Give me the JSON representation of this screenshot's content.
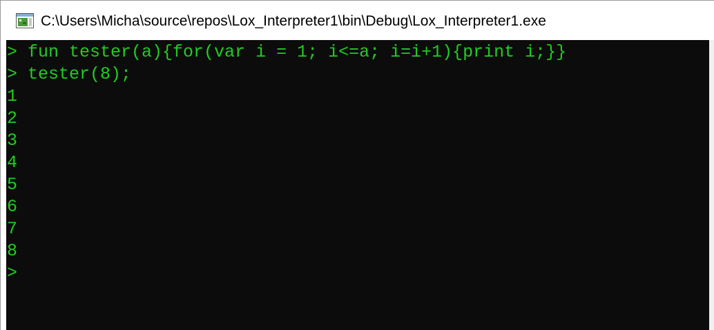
{
  "window": {
    "title": "C:\\Users\\Micha\\source\\repos\\Lox_Interpreter1\\bin\\Debug\\Lox_Interpreter1.exe",
    "icon": "console-app-icon"
  },
  "console": {
    "text_color": "#1fce1f",
    "background_color": "#0c0c0c",
    "lines": [
      {
        "prompt": "> ",
        "text": "fun tester(a){for(var i = 1; i<=a; i=i+1){print i;}}"
      },
      {
        "prompt": "> ",
        "text": "tester(8);"
      },
      {
        "prompt": "",
        "text": "1"
      },
      {
        "prompt": "",
        "text": "2"
      },
      {
        "prompt": "",
        "text": "3"
      },
      {
        "prompt": "",
        "text": "4"
      },
      {
        "prompt": "",
        "text": "5"
      },
      {
        "prompt": "",
        "text": "6"
      },
      {
        "prompt": "",
        "text": "7"
      },
      {
        "prompt": "",
        "text": "8"
      },
      {
        "prompt": ">",
        "text": ""
      }
    ]
  }
}
